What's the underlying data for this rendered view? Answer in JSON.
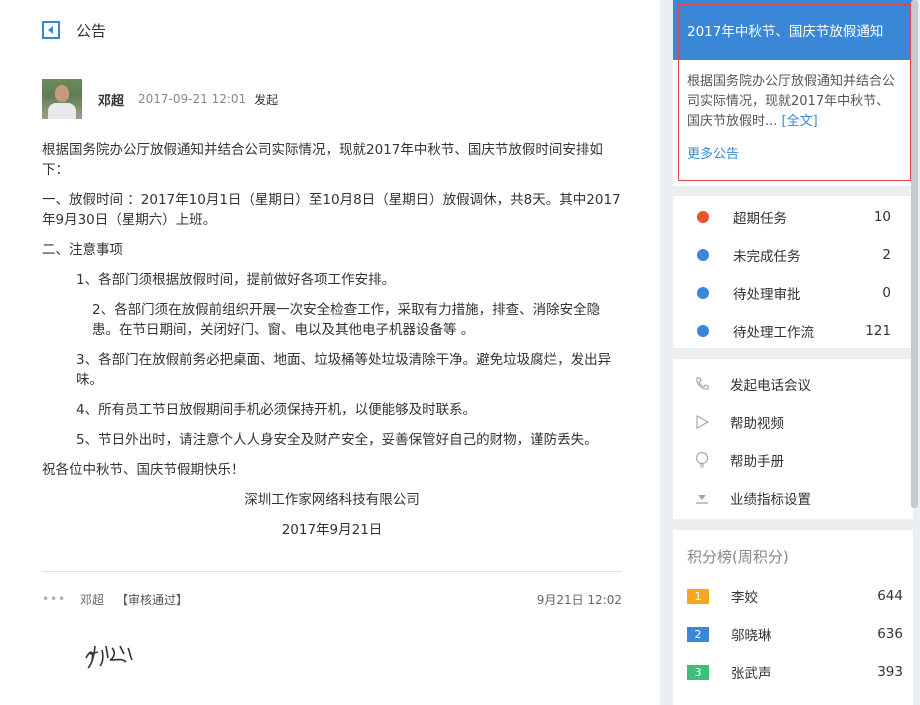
{
  "header": {
    "title": "公告"
  },
  "post": {
    "author": "邓超",
    "time": "2017-09-21 12:01",
    "action": "发起",
    "paragraphs": [
      " 根据国务院办公厅放假通知并结合公司实际情况，现就2017年中秋节、国庆节放假时间安排如下：",
      "一、放假时间 ：2017年10月1日（星期日）至10月8日（星期日）放假调休，共8天。其中2017年9月30日（星期六）上班。",
      "二、注意事项",
      "1、各部门须根据放假时间，提前做好各项工作安排。",
      "2、各部门须在放假前组织开展一次安全检查工作，采取有力措施，排查、消除安全隐患。在节日期间，关闭好门、窗、电以及其他电子机器设备等 。",
      "3、各部门在放假前务必把桌面、地面、垃圾桶等处垃圾清除干净。避免垃圾腐烂，发出异味。",
      "4、所有员工节日放假期间手机必须保持开机，以便能够及时联系。",
      "5、节日外出时，请注意个人人身安全及财产安全，妥善保管好自己的财物，谨防丢失。",
      "祝各位中秋节、国庆节假期快乐！",
      "深圳工作家网络科技有限公司",
      "2017年9月21日"
    ]
  },
  "footer": {
    "dots": "•••",
    "name": "邓超",
    "status": "【审核通过】",
    "time": "9月21日 12:02"
  },
  "notice": {
    "title": "2017年中秋节、国庆节放假通知",
    "summary": " 根据国务院办公厅放假通知并结合公司实际情况，现就2017年中秋节、国庆节放假时...",
    "full_link": "[全文]",
    "more": "更多公告"
  },
  "tasks": [
    {
      "label": "超期任务",
      "count": "10",
      "color": "#e8532b"
    },
    {
      "label": "未完成任务",
      "count": "2",
      "color": "#3a87d7"
    },
    {
      "label": "待处理审批",
      "count": "0",
      "color": "#3a87d7"
    },
    {
      "label": "待处理工作流",
      "count": "121",
      "color": "#3a87d7"
    }
  ],
  "tools": [
    {
      "label": "发起电话会议",
      "icon": "phone-icon"
    },
    {
      "label": "帮助视频",
      "icon": "play-icon"
    },
    {
      "label": "帮助手册",
      "icon": "lightbulb-icon"
    },
    {
      "label": "业绩指标设置",
      "icon": "download-icon"
    }
  ],
  "ranking": {
    "title": "积分榜(周积分)",
    "items": [
      {
        "rank": "1",
        "name": "李姣",
        "score": "644",
        "color": "#f5a623"
      },
      {
        "rank": "2",
        "name": "邬晓琳",
        "score": "636",
        "color": "#3a87d7"
      },
      {
        "rank": "3",
        "name": "张武声",
        "score": "393",
        "color": "#3cbf7a"
      }
    ]
  }
}
